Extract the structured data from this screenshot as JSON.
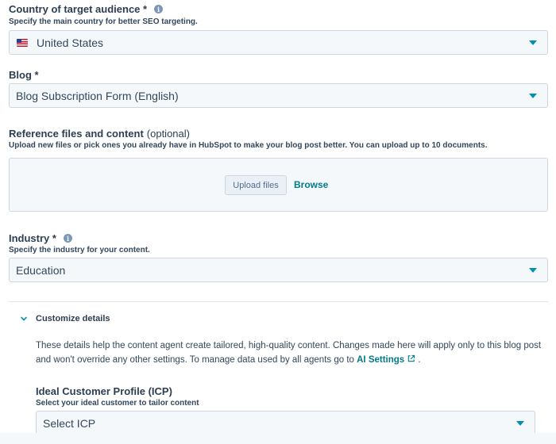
{
  "country": {
    "label": "Country of target audience *",
    "help": "Specify the main country for better SEO targeting.",
    "value": "United States",
    "flag_icon": "us-flag-icon"
  },
  "blog": {
    "label": "Blog *",
    "value": "Blog Subscription Form (English)"
  },
  "reference": {
    "label": "Reference files and content",
    "optional": "(optional)",
    "help": "Upload new files or pick ones you already have in HubSpot to make your blog post better. You can upload up to 10 documents.",
    "upload_button": "Upload files",
    "browse_link": "Browse"
  },
  "industry": {
    "label": "Industry *",
    "help": "Specify the industry for your content.",
    "value": "Education"
  },
  "customize": {
    "title": "Customize details",
    "description_before": "These details help the content agent create tailored, high-quality content. Changes made here will apply only to this blog post and won't override any other settings. To manage data used by all agents go to",
    "link_text": "AI Settings",
    "description_after": "."
  },
  "icp": {
    "label": "Ideal Customer Profile (ICP)",
    "help": "Select your ideal customer to tailor content",
    "placeholder": "Select ICP"
  },
  "colors": {
    "accent": "#0091ae",
    "link": "#007a8c",
    "text": "#33475b",
    "field_bg": "#f5f8fa",
    "border": "#cbd6e2"
  }
}
